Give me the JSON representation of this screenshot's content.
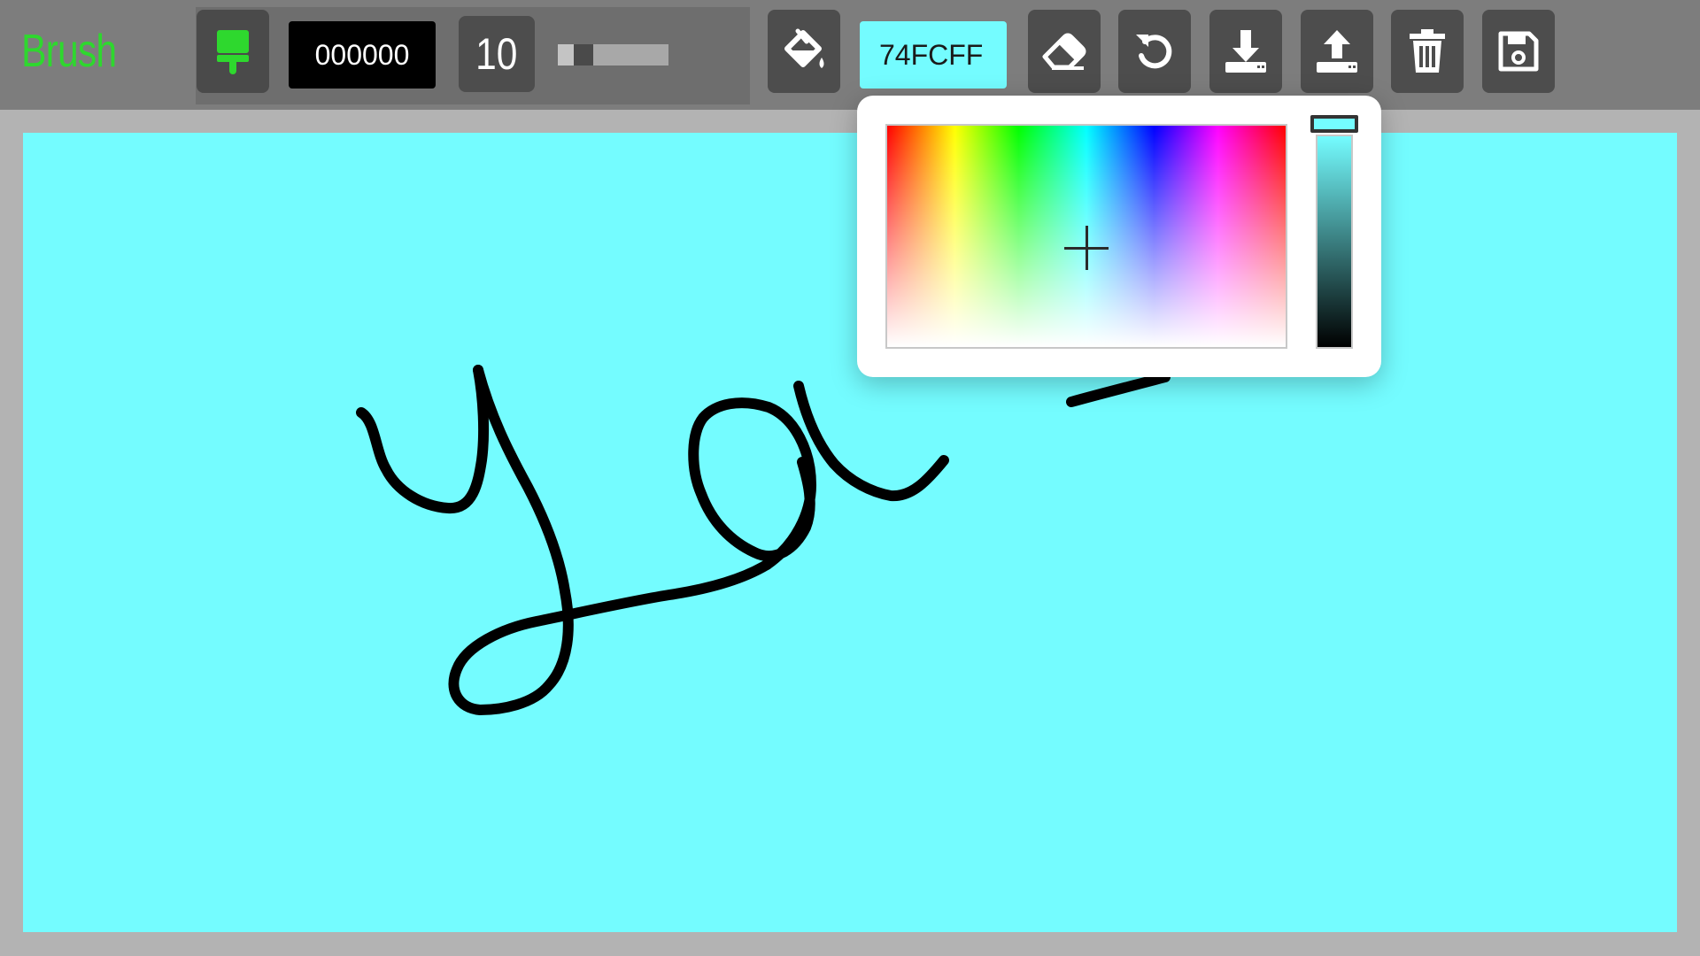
{
  "app": {
    "title": "Brush",
    "title_color": "#2ed82e"
  },
  "toolbar": {
    "brush_tool_icon": "paint-brush-icon",
    "brush_color_value": "000000",
    "brush_size_value": "10",
    "brush_size_slider_fraction": 0.1,
    "fill_tool_icon": "paint-bucket-icon",
    "fill_color_value": "74FCFF",
    "eraser_icon": "eraser-icon",
    "undo_icon": "undo-icon",
    "download_icon": "download-icon",
    "upload_icon": "upload-icon",
    "clear_icon": "trash-icon",
    "save_icon": "floppy-disk-icon"
  },
  "canvas": {
    "background_color": "#74fcff",
    "stroke_color": "#000000"
  },
  "color_picker": {
    "open": true,
    "selected_hex": "#74FCFF",
    "hue_fraction": 0.5,
    "saturation_fraction": 0.45,
    "value_fraction": 1.0
  }
}
